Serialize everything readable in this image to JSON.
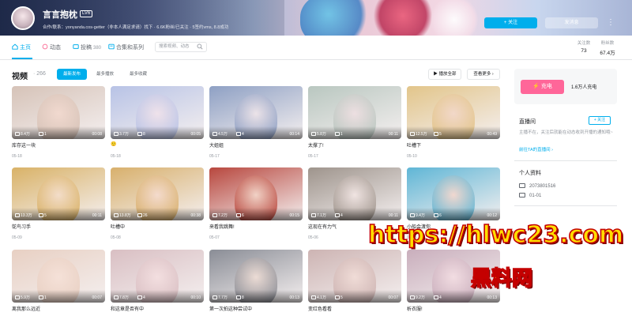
{
  "profile": {
    "name": "言言抱枕",
    "level": "LV6",
    "bio": "合作/联系：yonyanda.cos-getter（非本人满足求请）找下 · 6.6K粉丝/已关注 · 5签约vms, 8.8成功",
    "follow_label": "+ 关注",
    "message_label": "发消息",
    "more_label": "⋮"
  },
  "nav": {
    "tabs": [
      {
        "label": "主页",
        "icon": "home-icon",
        "count": ""
      },
      {
        "label": "动态",
        "icon": "feed-icon",
        "count": ""
      },
      {
        "label": "投稿",
        "icon": "upload-icon",
        "count": "380"
      },
      {
        "label": "合集和系列",
        "icon": "collection-icon",
        "count": ""
      }
    ],
    "search_placeholder": "搜索视频、动态",
    "stats": [
      {
        "label": "关注数",
        "value": "73"
      },
      {
        "label": "粉丝数",
        "value": "67.4万"
      }
    ]
  },
  "section": {
    "title": "视频",
    "count": "· 266",
    "sorts": [
      "最新发布",
      "最多播放",
      "最多收藏"
    ],
    "play_all": "▶ 播放全部",
    "see_more": "查看更多 ›"
  },
  "videos": [
    {
      "title": "库存这一块",
      "date": "05-18",
      "plays": "8.4万",
      "comments": "1",
      "duration": "00:08",
      "tone": "#d6c3b8",
      "face": "#f1d9cf"
    },
    {
      "title": "🙂",
      "date": "05-18",
      "plays": "3.7万",
      "comments": "8",
      "duration": "00:05",
      "tone": "#b8c3e6",
      "face": "#efe2ea"
    },
    {
      "title": "大姐姐",
      "date": "05-17",
      "plays": "4.5万",
      "comments": "4",
      "duration": "00:14",
      "tone": "#8ea0c4",
      "face": "#ece3e8"
    },
    {
      "title": "太撑了!",
      "date": "05-17",
      "plays": "5.8万",
      "comments": "1",
      "duration": "00:11",
      "tone": "#b9c7c0",
      "face": "#eddfe1"
    },
    {
      "title": "吐槽下",
      "date": "05-10",
      "plays": "12.5万",
      "comments": "5",
      "duration": "00:49",
      "tone": "#e2c58a",
      "face": "#f2d8c9"
    },
    {
      "title": "鸵鸟习手",
      "date": "05-09",
      "plays": "13.3万",
      "comments": "5",
      "duration": "00:11",
      "tone": "#d9b267",
      "face": "#f3ddc9"
    },
    {
      "title": "吐槽中",
      "date": "05-08",
      "plays": "13.8万",
      "comments": "26",
      "duration": "00:38",
      "tone": "#d8b06c",
      "face": "#f4dbcd"
    },
    {
      "title": "来看我跳舞!",
      "date": "05-07",
      "plays": "7.2万",
      "comments": "6",
      "duration": "00:15",
      "tone": "#b8473e",
      "face": "#f1d2c6"
    },
    {
      "title": "这现在有力气",
      "date": "05-06",
      "plays": "7.1万",
      "comments": "4",
      "duration": "00:11",
      "tone": "#9e948c",
      "face": "#f0e4e2"
    },
    {
      "title": "小船会渡你",
      "date": "05-05",
      "plays": "9.4万",
      "comments": "6",
      "duration": "00:12",
      "tone": "#5fb6d6",
      "face": "#f1d8cf"
    },
    {
      "title": "离我那么远近",
      "date": "",
      "plays": "5.9万",
      "comments": "1",
      "duration": "00:07",
      "tone": "#e8d0c3",
      "face": "#f5e1d8"
    },
    {
      "title": "和这章是否有中",
      "date": "",
      "plays": "7.8万",
      "comments": "4",
      "duration": "00:10",
      "tone": "#d9bfc3",
      "face": "#f3dfe0"
    },
    {
      "title": "第一次拍这种尝试中",
      "date": "",
      "plays": "7.7万",
      "comments": "8",
      "duration": "00:13",
      "tone": "#8a8d96",
      "face": "#ecdcd5"
    },
    {
      "title": "变红色看看",
      "date": "",
      "plays": "4.1万",
      "comments": "5",
      "duration": "00:07",
      "tone": "#cdb4b3",
      "face": "#f0dcd7"
    },
    {
      "title": "析衣服!",
      "date": "",
      "plays": "9.2万",
      "comments": "4",
      "duration": "00:13",
      "tone": "#c9aebc",
      "face": "#f2dde2"
    }
  ],
  "sidebar": {
    "charge_label": "⚡ 充电",
    "charge_count": "1.6万人充电",
    "live_title": "直播间",
    "live_follow": "+ 关注",
    "live_desc": "主播不在，关注后就能在动态收到开播的通知哦~",
    "live_link": "前往TA的直播间 ›",
    "info_title": "个人资料",
    "uid": "2073801516",
    "birthday": "01-01"
  },
  "watermark": {
    "url": "https://hlwc23.com",
    "sub": "黑料网"
  },
  "colors": {
    "accent": "#00aeec",
    "charge": "#ff6699",
    "watermark_fill": "#ffde00",
    "watermark_stroke": "#c40000"
  }
}
